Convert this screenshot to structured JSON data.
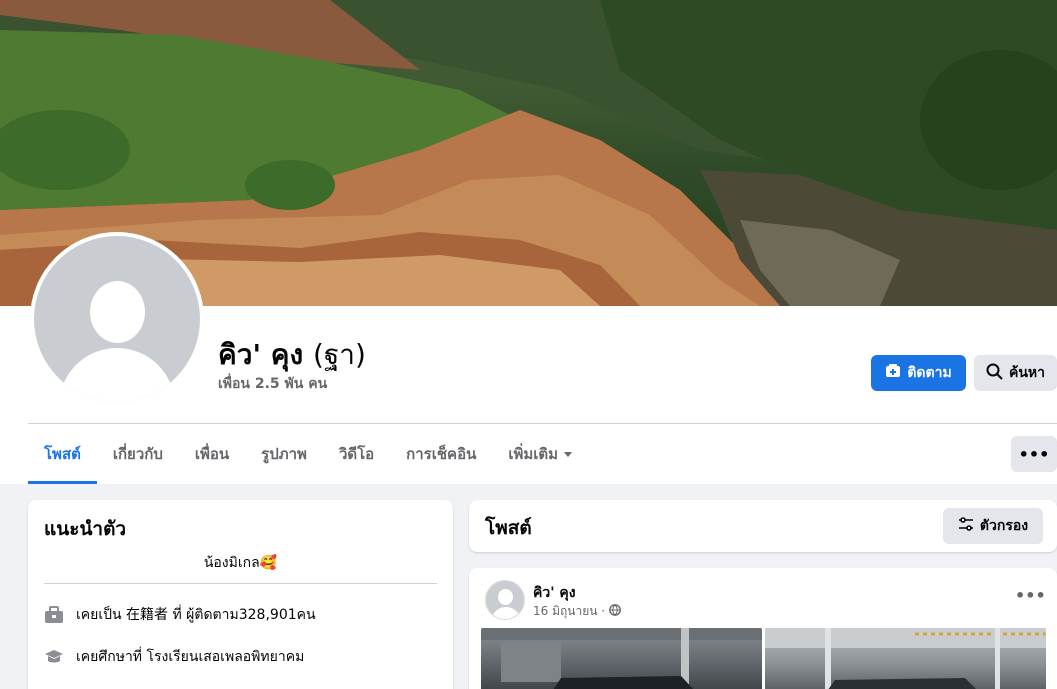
{
  "profile": {
    "name": "คิว' คุง",
    "alternate_name": "(ฐา)",
    "friends_count": "เพื่อน 2.5 พัน คน"
  },
  "actions": {
    "follow_label": "ติดตาม",
    "search_label": "ค้นหา",
    "more_label": "•••"
  },
  "tabs": [
    {
      "label": "โพสต์",
      "active": true
    },
    {
      "label": "เกี่ยวกับ"
    },
    {
      "label": "เพื่อน"
    },
    {
      "label": "รูปภาพ"
    },
    {
      "label": "วิดีโอ"
    },
    {
      "label": "การเช็คอิน"
    },
    {
      "label": "เพิ่มเติม"
    }
  ],
  "intro": {
    "title": "แนะนำตัว",
    "bio": "น้องมิเกล🥰",
    "items": [
      {
        "icon": "briefcase-icon",
        "text": "เคยเป็น 在籍者 ที่ ผู้ติดตาม328,901คน"
      },
      {
        "icon": "graduation-cap-icon",
        "text": "เคยศึกษาที่ โรงเรียนเสอเพลอพิทยาคม"
      }
    ]
  },
  "posts_section": {
    "title": "โพสต์",
    "filter_label": "ตัวกรอง"
  },
  "post": {
    "author": "คิว' คุง",
    "date": "16 มิถุนายน ·",
    "privacy_icon": "globe-icon",
    "more_label": "•••"
  },
  "colors": {
    "accent": "#1b74e4",
    "background": "#f0f2f5",
    "secondary_button": "#e4e6eb"
  }
}
